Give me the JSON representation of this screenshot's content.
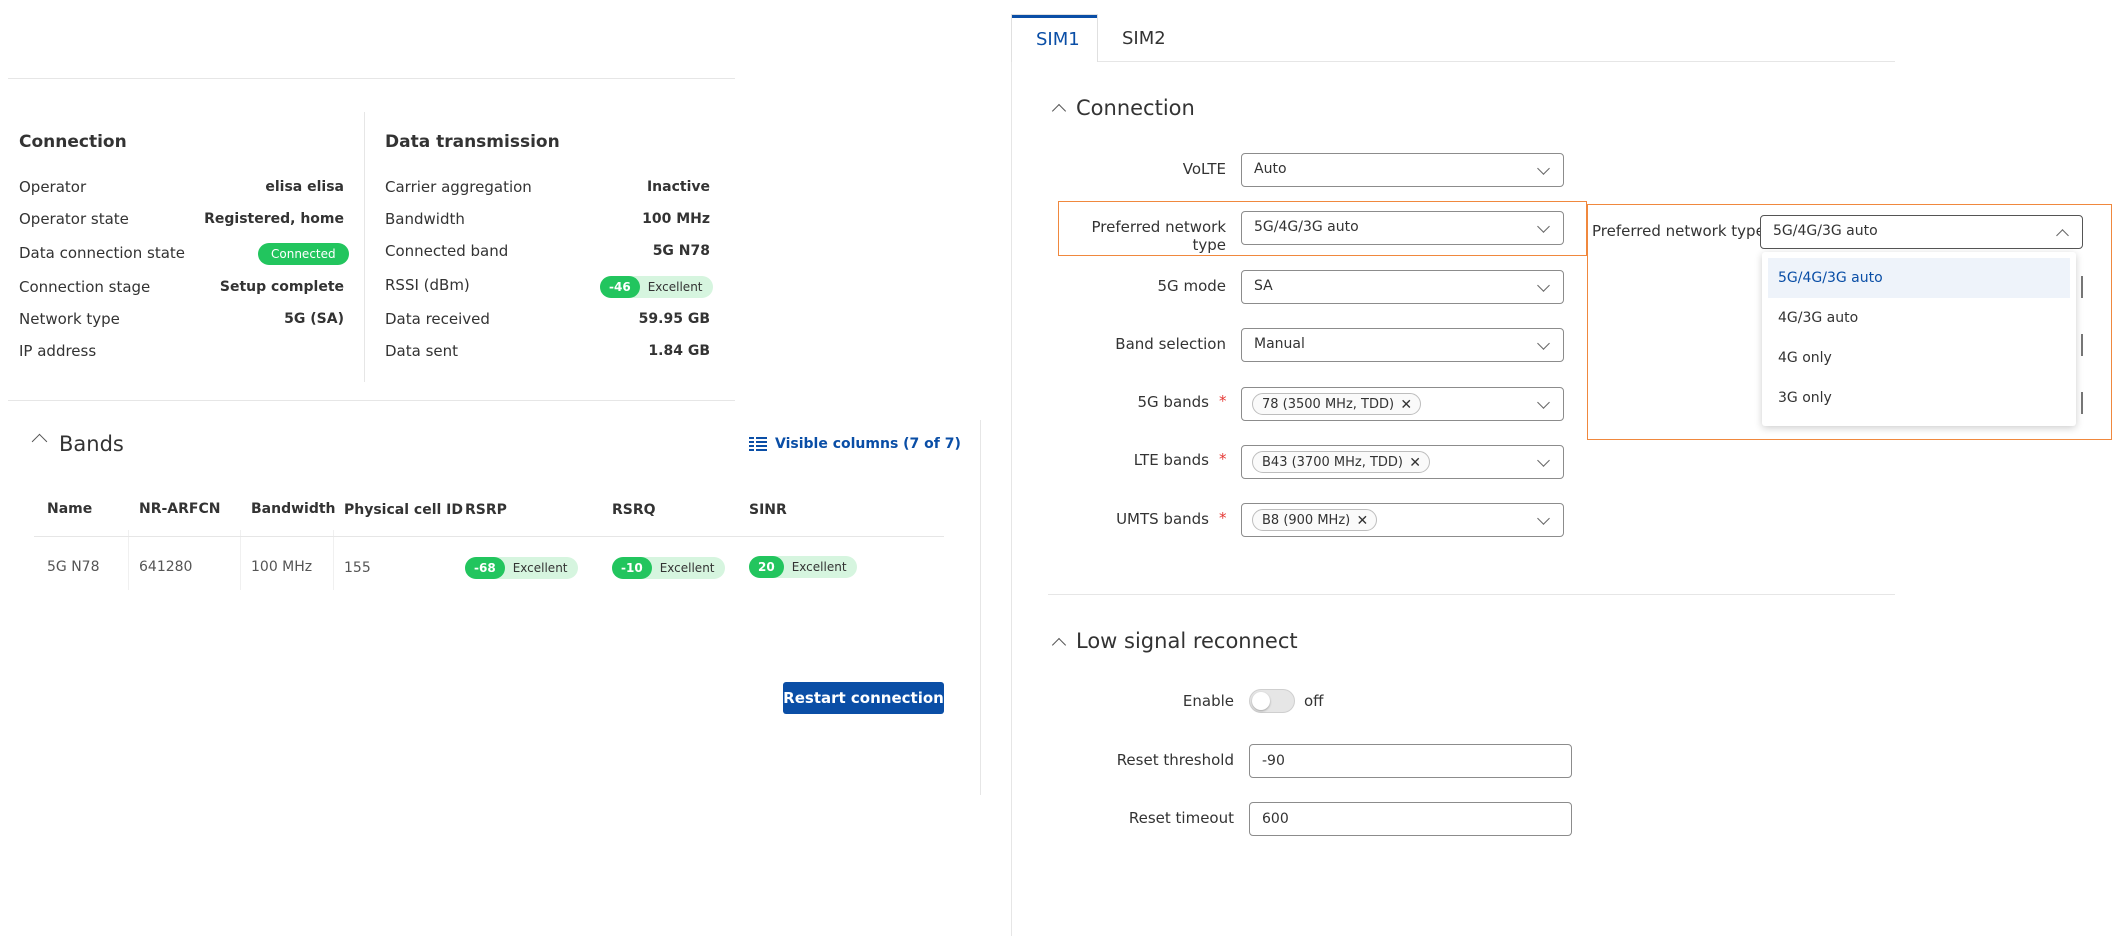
{
  "connection_card": {
    "title": "Connection",
    "rows": [
      {
        "label": "Operator",
        "value": "elisa elisa"
      },
      {
        "label": "Operator state",
        "value": "Registered, home"
      },
      {
        "label": "Data connection state",
        "value": "Connected"
      },
      {
        "label": "Connection stage",
        "value": "Setup complete"
      },
      {
        "label": "Network type",
        "value": "5G (SA)"
      },
      {
        "label": "IP address",
        "value": ""
      }
    ]
  },
  "data_card": {
    "title": "Data transmission",
    "rows": [
      {
        "label": "Carrier aggregation",
        "value": "Inactive"
      },
      {
        "label": "Bandwidth",
        "value": "100 MHz"
      },
      {
        "label": "Connected band",
        "value": "5G N78"
      },
      {
        "label": "RSSI (dBm)",
        "value": "-46",
        "quality": "Excellent"
      },
      {
        "label": "Data received",
        "value": "59.95 GB"
      },
      {
        "label": "Data sent",
        "value": "1.84 GB"
      }
    ]
  },
  "bands": {
    "title": "Bands",
    "visible_columns": "Visible columns (7 of 7)",
    "columns": [
      "Name",
      "NR-ARFCN",
      "Bandwidth",
      "Physical cell ID",
      "RSRP",
      "RSRQ",
      "SINR"
    ],
    "rows": [
      {
        "name": "5G N78",
        "arfcn": "641280",
        "bandwidth": "100 MHz",
        "pci": "155",
        "rsrp": "-68",
        "rsrp_q": "Excellent",
        "rsrq": "-10",
        "rsrq_q": "Excellent",
        "sinr": "20",
        "sinr_q": "Excellent"
      }
    ],
    "restart_button": "Restart connection"
  },
  "tabs": [
    "SIM1",
    "SIM2"
  ],
  "connection_section": {
    "title": "Connection",
    "volte": {
      "label": "VoLTE",
      "value": "Auto"
    },
    "network_type": {
      "label": "Preferred network type",
      "value": "5G/4G/3G auto"
    },
    "mode_5g": {
      "label": "5G mode",
      "value": "SA"
    },
    "band_selection": {
      "label": "Band selection",
      "value": "Manual"
    },
    "bands_5g": {
      "label": "5G bands",
      "tag": "78 (3500 MHz, TDD)"
    },
    "lte_bands": {
      "label": "LTE bands",
      "tag": "B43 (3700 MHz, TDD)"
    },
    "umts_bands": {
      "label": "UMTS bands",
      "tag": "B8 (900 MHz)"
    },
    "required_mark": "*",
    "remove_glyph": "✕"
  },
  "dropdown_zoom": {
    "label": "Preferred network type",
    "value": "5G/4G/3G auto",
    "options": [
      "5G/4G/3G auto",
      "4G/3G auto",
      "4G only",
      "3G only"
    ],
    "selected_index": 0
  },
  "low_signal": {
    "title": "Low signal reconnect",
    "enable_label": "Enable",
    "enable_state": "off",
    "threshold_label": "Reset threshold",
    "threshold_value": "-90",
    "timeout_label": "Reset timeout",
    "timeout_value": "600"
  },
  "colors": {
    "accent": "#0a4ea6",
    "success": "#22c55e",
    "success_light": "#d6f5df",
    "highlight": "#f0883e"
  }
}
